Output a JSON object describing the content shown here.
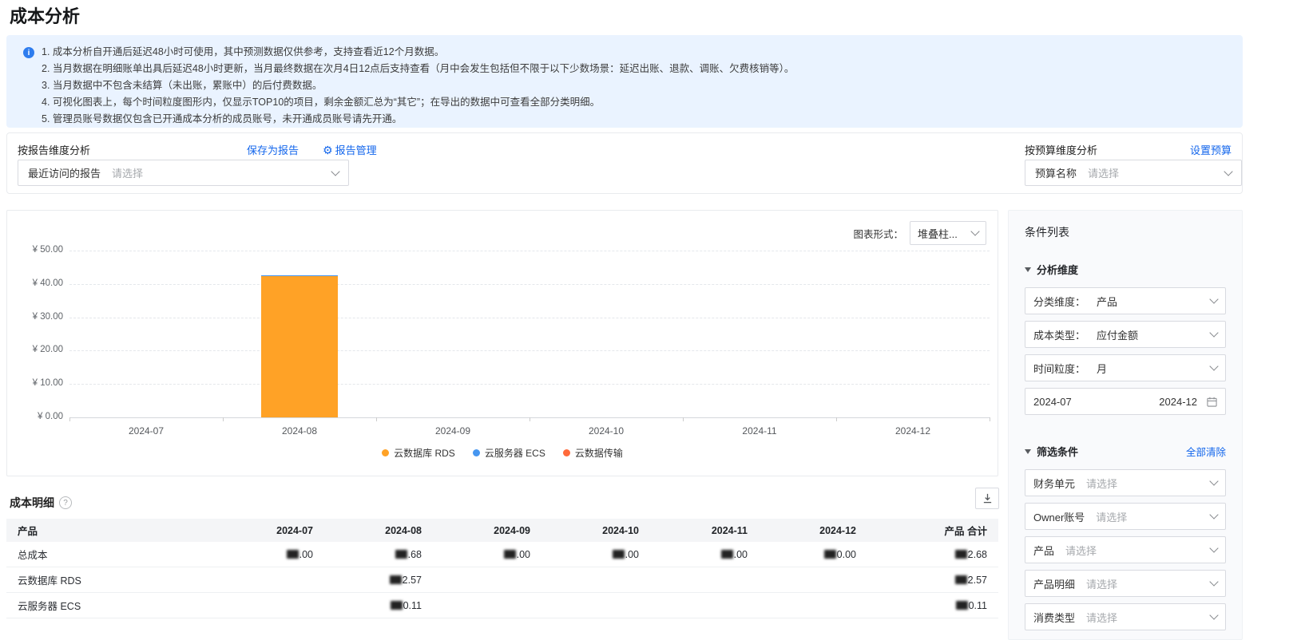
{
  "page": {
    "title": "成本分析"
  },
  "banner": {
    "lines": [
      "1. 成本分析自开通后延迟48小时可使用，其中预测数据仅供参考，支持查看近12个月数据。",
      "2. 当月数据在明细账单出具后延迟48小时更新，当月最终数据在次月4日12点后支持查看（月中会发生包括但不限于以下少数场景：延迟出账、退款、调账、欠费核销等）。",
      "3. 当月数据中不包含未结算（未出账，累账中）的后付费数据。",
      "4. 可视化图表上，每个时间粒度图形内，仅显示TOP10的项目，剩余金额汇总为“其它”；在导出的数据中可查看全部分类明细。",
      "5. 管理员账号数据仅包含已开通成本分析的成员账号，未开通成员账号请先开通。"
    ]
  },
  "report_panel": {
    "title": "按报告维度分析",
    "save_link": "保存为报告",
    "manage_link": "报告管理",
    "select_label": "最近访问的报告",
    "select_placeholder": "请选择"
  },
  "budget_panel": {
    "title": "按预算维度分析",
    "settings_link": "设置预算",
    "select_label": "预算名称",
    "select_placeholder": "请选择"
  },
  "chart": {
    "form_label": "图表形式：",
    "form_value": "堆叠柱..."
  },
  "chart_data": {
    "type": "bar",
    "stacked": true,
    "title": "",
    "categories": [
      "2024-07",
      "2024-08",
      "2024-09",
      "2024-10",
      "2024-11",
      "2024-12"
    ],
    "series": [
      {
        "name": "云数据库 RDS",
        "color": "#FFA226",
        "values": [
          0,
          42.57,
          0,
          0,
          0,
          0
        ]
      },
      {
        "name": "云服务器 ECS",
        "color": "#4696F0",
        "values": [
          0,
          0.11,
          0,
          0,
          0,
          0
        ]
      },
      {
        "name": "云数据传输",
        "color": "#FF6A3B",
        "values": [
          0,
          0,
          0,
          0,
          0,
          0
        ]
      }
    ],
    "ylim": [
      0,
      50
    ],
    "yticks": [
      0,
      10,
      20,
      30,
      40,
      50
    ],
    "ytick_prefix": "¥ ",
    "grid": true,
    "legend_position": "bottom"
  },
  "conditions": {
    "title": "条件列表",
    "analysis": {
      "title": "分析维度",
      "fields": [
        {
          "name": "category-dimension",
          "label": "分类维度：",
          "value": "产品"
        },
        {
          "name": "cost-type",
          "label": "成本类型：",
          "value": "应付金额"
        },
        {
          "name": "time-granularity",
          "label": "时间粒度：",
          "value": "月"
        }
      ],
      "date_start": "2024-07",
      "date_end": "2024-12"
    },
    "filters": {
      "title": "筛选条件",
      "clear_all": "全部清除",
      "fields": [
        {
          "name": "finance-unit",
          "label": "财务单元",
          "placeholder": "请选择"
        },
        {
          "name": "owner-account",
          "label": "Owner账号",
          "placeholder": "请选择"
        },
        {
          "name": "product",
          "label": "产品",
          "placeholder": "请选择"
        },
        {
          "name": "product-detail",
          "label": "产品明细",
          "placeholder": "请选择"
        },
        {
          "name": "consume-type",
          "label": "消费类型",
          "placeholder": "请选择"
        }
      ]
    }
  },
  "detail": {
    "title": "成本明细",
    "headers": [
      "产品",
      "2024-07",
      "2024-08",
      "2024-09",
      "2024-10",
      "2024-11",
      "2024-12",
      "产品 合计"
    ],
    "rows": [
      {
        "name": "总成本",
        "cells": [
          {
            "masked": true,
            "text": ".00"
          },
          {
            "masked": true,
            "text": ".68"
          },
          {
            "masked": true,
            "text": ".00"
          },
          {
            "masked": true,
            "text": ".00"
          },
          {
            "masked": true,
            "text": ".00"
          },
          {
            "masked": true,
            "text": "0.00"
          },
          {
            "masked": true,
            "text": "2.68"
          }
        ]
      },
      {
        "name": "云数据库 RDS",
        "cells": [
          null,
          {
            "masked": true,
            "text": "2.57"
          },
          null,
          null,
          null,
          null,
          {
            "masked": true,
            "text": "2.57"
          }
        ]
      },
      {
        "name": "云服务器 ECS",
        "cells": [
          null,
          {
            "masked": true,
            "text": "0.11"
          },
          null,
          null,
          null,
          null,
          {
            "masked": true,
            "text": "0.11"
          }
        ]
      }
    ]
  }
}
